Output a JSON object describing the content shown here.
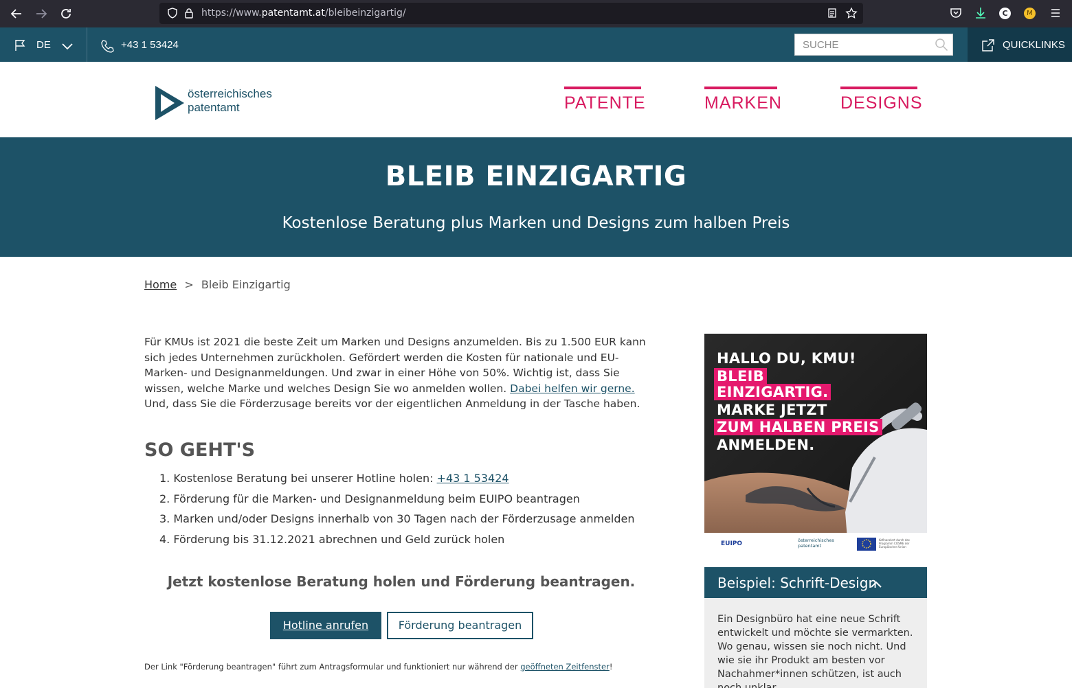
{
  "browser": {
    "url_prefix": "https://www.",
    "url_domain": "patentamt.at",
    "url_path": "/bleibeinzigartig/",
    "profile_c": "C",
    "profile_m": "M"
  },
  "utility_bar": {
    "language": "DE",
    "phone": "+43 1 53424",
    "search_placeholder": "SUCHE",
    "quicklinks": "QUICKLINKS"
  },
  "header": {
    "logo_line1": "österreichisches",
    "logo_line2": "patentamt",
    "nav": [
      "PATENTE",
      "MARKEN",
      "DESIGNS"
    ],
    "accent_color": "#d81b60"
  },
  "hero": {
    "title": "BLEIB EINZIGARTIG",
    "subtitle": "Kostenlose Beratung plus Marken und Designs zum halben Preis",
    "background": "#1d5267"
  },
  "breadcrumb": {
    "home": "Home",
    "separator": ">",
    "current": "Bleib Einzigartig"
  },
  "intro": {
    "text_before_link": "Für KMUs ist 2021 die beste Zeit um Marken und Designs anzumelden. Bis zu 1.500 EUR kann sich jedes Unternehmen zurückholen. Gefördert werden die Kosten für nationale und EU-Marken- und Designanmeldungen. Und zwar in einer Höhe von 50%. Wichtig ist, dass Sie wissen, welche Marke und welches Design Sie wo anmelden wollen. ",
    "link": "Dabei helfen wir gerne.",
    "text_after_link": " Und, dass Sie die Förderzusage bereits vor der eigentlichen Anmeldung in der Tasche haben."
  },
  "steps": {
    "heading": "SO GEHT'S",
    "items": [
      {
        "number": "1.",
        "text": "Kostenlose Beratung bei unserer Hotline holen: ",
        "link": "+43 1 53424"
      },
      {
        "number": "2.",
        "text": "Förderung für die Marken- und Designanmeldung beim EUIPO beantragen"
      },
      {
        "number": "3.",
        "text": "Marken und/oder Designs innerhalb von 30 Tagen nach der Förderzusage anmelden"
      },
      {
        "number": "4.",
        "text": "Förderung bis 31.12.2021 abrechnen und Geld zurück holen"
      }
    ]
  },
  "cta": {
    "text": "Jetzt kostenlose Beratung holen und Förderung beantragen.",
    "primary_button": "Hotline anrufen",
    "secondary_button": "Förderung beantragen"
  },
  "footnote": {
    "text": "Der Link \"Förderung beantragen\" führt zum Antragsformular und funktioniert nur während der ",
    "link": "geöffneten Zeitfenster",
    "end": "!"
  },
  "promo": {
    "line1": "HALLO DU, KMU!",
    "line2": "BLEIB",
    "line3": "EINZIGARTIG.",
    "line4": "MARKE JETZT",
    "line5": "ZUM HALBEN PREIS",
    "line6": "ANMELDEN.",
    "footer_euipo": "EUIPO",
    "footer_logo1": "österreichisches",
    "footer_logo2": "patentamt",
    "footer_eu_text": "Kofinanziert durch das Programm COSME der Europäischen Union",
    "highlight_color": "#e5196e"
  },
  "accordion": {
    "title": "Beispiel: Schrift-Design",
    "body": "Ein Designbüro hat eine neue Schrift entwickelt und möchte sie vermarkten. Wo genau, wissen sie noch nicht. Und wie sie ihr Produkt am besten vor Nachahmer*innen schützen, ist auch noch unklar."
  }
}
